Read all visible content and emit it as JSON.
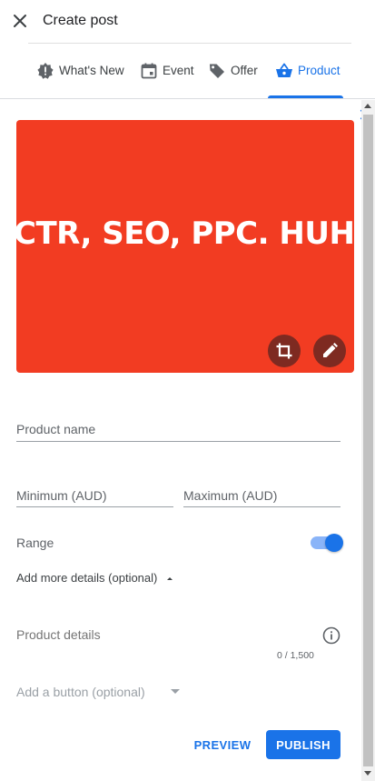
{
  "header": {
    "title": "Create post",
    "close_icon": "close-icon"
  },
  "tabs": [
    {
      "label": "What's New",
      "icon": "whats-new-icon",
      "active": false
    },
    {
      "label": "Event",
      "icon": "calendar-icon",
      "active": false
    },
    {
      "label": "Offer",
      "icon": "tag-icon",
      "active": false
    },
    {
      "label": "Product",
      "icon": "basket-icon",
      "active": true
    }
  ],
  "tab_next_icon": "chevron-right-icon",
  "image": {
    "text": "CTR, SEO, PPC. HUH?",
    "background": "#f23c22"
  },
  "form": {
    "product_name_placeholder": "Product name",
    "product_name_value": "",
    "minimum_placeholder": "Minimum (AUD)",
    "minimum_value": "",
    "maximum_placeholder": "Maximum (AUD)",
    "maximum_value": "",
    "range_label": "Range",
    "range_enabled": true,
    "more_details_label": "Add more details (optional)",
    "product_details_placeholder": "Product details",
    "product_details_value": "",
    "char_counter": "0 / 1,500",
    "button_select_label": "Add a button (optional)"
  },
  "actions": {
    "preview_label": "PREVIEW",
    "publish_label": "PUBLISH"
  },
  "colors": {
    "accent": "#1a73e8",
    "image_bg": "#f23c22",
    "image_button": "#7e2a21"
  }
}
